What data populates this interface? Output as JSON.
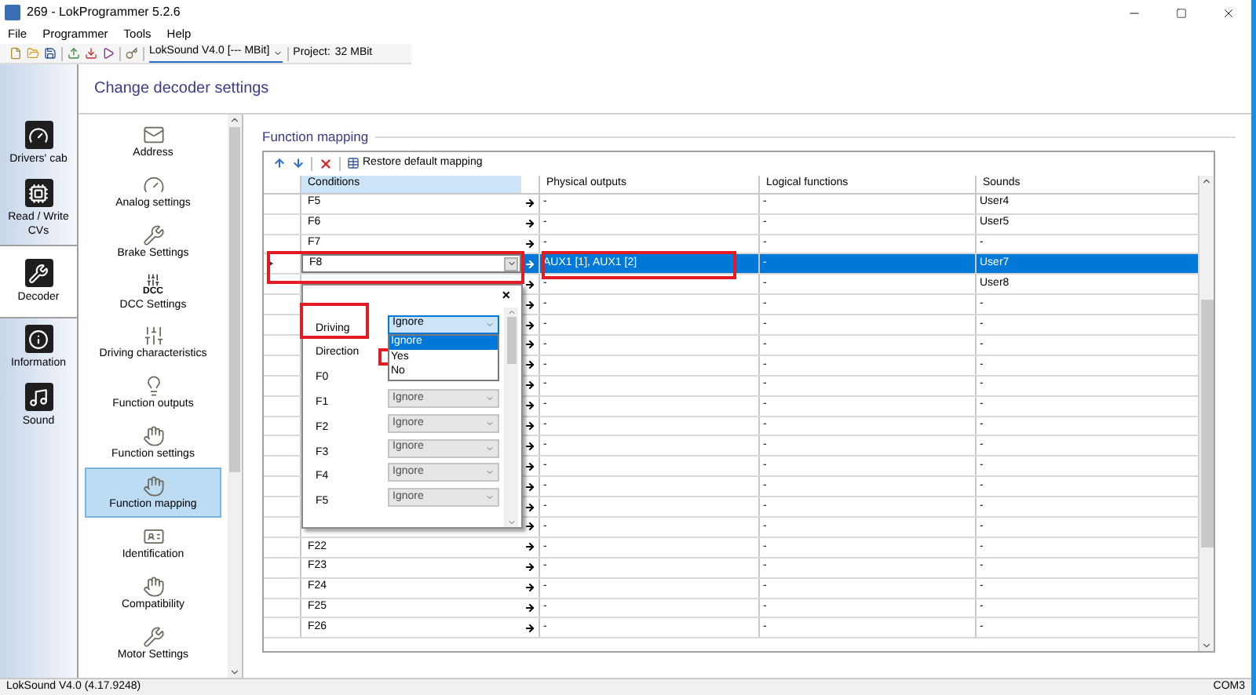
{
  "window": {
    "title": "269 - LokProgrammer 5.2.6"
  },
  "menu": [
    "File",
    "Programmer",
    "Tools",
    "Help"
  ],
  "toolbar": {
    "decoder": "LokSound V4.0 [--- MBit]",
    "project_label": "Project:",
    "project_value": "32 MBit"
  },
  "header": "Change decoder settings",
  "nav": [
    {
      "label": "Drivers' cab",
      "selected": false
    },
    {
      "label": "Read / Write CVs",
      "selected": false
    },
    {
      "label": "Decoder",
      "selected": true
    },
    {
      "label": "Information",
      "selected": false
    },
    {
      "label": "Sound",
      "selected": false
    }
  ],
  "settings_list": [
    {
      "label": "Address",
      "selected": false
    },
    {
      "label": "Analog settings",
      "selected": false
    },
    {
      "label": "Brake Settings",
      "selected": false
    },
    {
      "label": "DCC Settings",
      "icon_text": "DCC",
      "selected": false
    },
    {
      "label": "Driving characteristics",
      "selected": false
    },
    {
      "label": "Function outputs",
      "selected": false
    },
    {
      "label": "Function settings",
      "selected": false
    },
    {
      "label": "Function mapping",
      "selected": true
    },
    {
      "label": "Identification",
      "selected": false
    },
    {
      "label": "Compatibility",
      "selected": false
    },
    {
      "label": "Motor Settings",
      "selected": false
    }
  ],
  "mapping": {
    "title": "Function mapping",
    "restore_button": "Restore default mapping",
    "columns": [
      "Conditions",
      "Physical outputs",
      "Logical functions",
      "Sounds"
    ],
    "rows": [
      {
        "condition": "F5",
        "physical": "-",
        "logical": "-",
        "sound": "User4",
        "selected": false
      },
      {
        "condition": "F6",
        "physical": "-",
        "logical": "-",
        "sound": "User5",
        "selected": false
      },
      {
        "condition": "F7",
        "physical": "-",
        "logical": "-",
        "sound": "-",
        "selected": false
      },
      {
        "condition": "F8",
        "physical": "AUX1 [1], AUX1 [2]",
        "logical": "-",
        "sound": "User7",
        "selected": true
      },
      {
        "physical": "-",
        "logical": "-",
        "sound": "User8",
        "selected": false
      },
      {
        "physical": "-",
        "logical": "-",
        "sound": "-",
        "selected": false
      },
      {
        "physical": "-",
        "logical": "-",
        "sound": "-",
        "selected": false
      },
      {
        "physical": "-",
        "logical": "-",
        "sound": "-",
        "selected": false
      },
      {
        "physical": "-",
        "logical": "-",
        "sound": "-",
        "selected": false
      },
      {
        "physical": "-",
        "logical": "-",
        "sound": "-",
        "selected": false
      },
      {
        "physical": "-",
        "logical": "-",
        "sound": "-",
        "selected": false
      },
      {
        "physical": "-",
        "logical": "-",
        "sound": "-",
        "selected": false
      },
      {
        "physical": "-",
        "logical": "-",
        "sound": "-",
        "selected": false
      },
      {
        "physical": "-",
        "logical": "-",
        "sound": "-",
        "selected": false
      },
      {
        "physical": "-",
        "logical": "-",
        "sound": "-",
        "selected": false
      },
      {
        "physical": "-",
        "logical": "-",
        "sound": "-",
        "selected": false
      },
      {
        "physical": "-",
        "logical": "-",
        "sound": "-",
        "selected": false
      },
      {
        "condition": "F22",
        "physical": "-",
        "logical": "-",
        "sound": "-",
        "selected": false
      },
      {
        "condition": "F23",
        "physical": "-",
        "logical": "-",
        "sound": "-",
        "selected": false
      },
      {
        "condition": "F24",
        "physical": "-",
        "logical": "-",
        "sound": "-",
        "selected": false
      },
      {
        "condition": "F25",
        "physical": "-",
        "logical": "-",
        "sound": "-",
        "selected": false
      },
      {
        "condition": "F26",
        "physical": "-",
        "logical": "-",
        "sound": "-",
        "selected": false
      }
    ],
    "condition_popup": {
      "close": "×",
      "items": [
        {
          "label": "Driving",
          "value": "Ignore",
          "options": [
            {
              "label": "Ignore",
              "selected": true
            },
            {
              "label": "Yes",
              "selected": false
            },
            {
              "label": "No",
              "selected": false
            }
          ]
        },
        {
          "label": "Direction"
        },
        {
          "label": "F0"
        },
        {
          "label": "F1",
          "value": "Ignore"
        },
        {
          "label": "F2",
          "value": "Ignore"
        },
        {
          "label": "F3",
          "value": "Ignore"
        },
        {
          "label": "F4",
          "value": "Ignore"
        },
        {
          "label": "F5",
          "value": "Ignore"
        }
      ]
    }
  },
  "status_bar": {
    "left": "LokSound V4.0 (4.17.9248)",
    "right": "COM3"
  }
}
